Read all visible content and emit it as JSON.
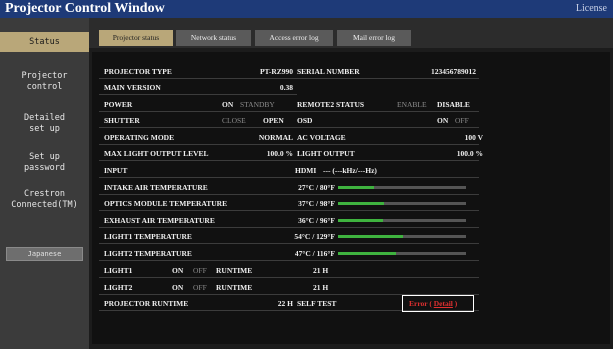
{
  "window": {
    "title": "Projector Control Window",
    "license": "License"
  },
  "sidebar": {
    "items": [
      {
        "label": "Status",
        "active": true
      },
      {
        "label": "Projector\ncontrol",
        "active": false
      },
      {
        "label": "Detailed\nset up",
        "active": false
      },
      {
        "label": "Set up\npassword",
        "active": false
      },
      {
        "label": "Crestron\nConnected(TM)",
        "active": false
      }
    ],
    "language_button": "Japanese"
  },
  "tabs": [
    {
      "label": "Projector status",
      "active": true
    },
    {
      "label": "Network status",
      "active": false
    },
    {
      "label": "Access error log",
      "active": false
    },
    {
      "label": "Mail error log",
      "active": false
    }
  ],
  "status": {
    "projector_type_label": "PROJECTOR TYPE",
    "projector_type": "PT-RZ990",
    "serial_label": "SERIAL NUMBER",
    "serial": "123456789012",
    "main_version_label": "MAIN VERSION",
    "main_version": "0.38",
    "power_label": "POWER",
    "power_on": "ON",
    "power_standby": "STANDBY",
    "remote2_label": "REMOTE2 STATUS",
    "remote2_enable": "ENABLE",
    "remote2_disable": "DISABLE",
    "shutter_label": "SHUTTER",
    "shutter_close": "CLOSE",
    "shutter_open": "OPEN",
    "osd_label": "OSD",
    "osd_on": "ON",
    "osd_off": "OFF",
    "operating_mode_label": "OPERATING MODE",
    "operating_mode": "NORMAL",
    "ac_voltage_label": "AC VOLTAGE",
    "ac_voltage": "100 V",
    "max_light_label": "MAX LIGHT OUTPUT LEVEL",
    "max_light": "100.0 %",
    "light_output_label": "LIGHT OUTPUT",
    "light_output": "100.0 %",
    "input_label": "INPUT",
    "input_value": "HDMI",
    "input_freq": "--- (---kHz/---Hz)",
    "temps": [
      {
        "label": "INTAKE AIR TEMPERATURE",
        "value": "27°C / 80°F",
        "level": 0.28
      },
      {
        "label": "OPTICS MODULE TEMPERATURE",
        "value": "37°C / 98°F",
        "level": 0.36
      },
      {
        "label": "EXHAUST AIR TEMPERATURE",
        "value": "36°C / 96°F",
        "level": 0.35
      },
      {
        "label": "LIGHT1 TEMPERATURE",
        "value": "54°C / 129°F",
        "level": 0.51
      },
      {
        "label": "LIGHT2 TEMPERATURE",
        "value": "47°C / 116°F",
        "level": 0.45
      }
    ],
    "light1_label": "LIGHT1",
    "light1_on": "ON",
    "light1_off": "OFF",
    "light1_runtime_label": "RUNTIME",
    "light1_runtime": "21 H",
    "light2_label": "LIGHT2",
    "light2_on": "ON",
    "light2_off": "OFF",
    "light2_runtime_label": "RUNTIME",
    "light2_runtime": "21 H",
    "projector_runtime_label": "PROJECTOR RUNTIME",
    "projector_runtime": "22 H",
    "self_test_label": "SELF TEST",
    "self_test_error": "Error (",
    "self_test_detail": "Detail",
    "self_test_close": ")"
  },
  "colors": {
    "accent": "#b9a779",
    "titlebar": "#1e3a78",
    "bar_fill": "#3fb33f",
    "error": "#e03030"
  }
}
